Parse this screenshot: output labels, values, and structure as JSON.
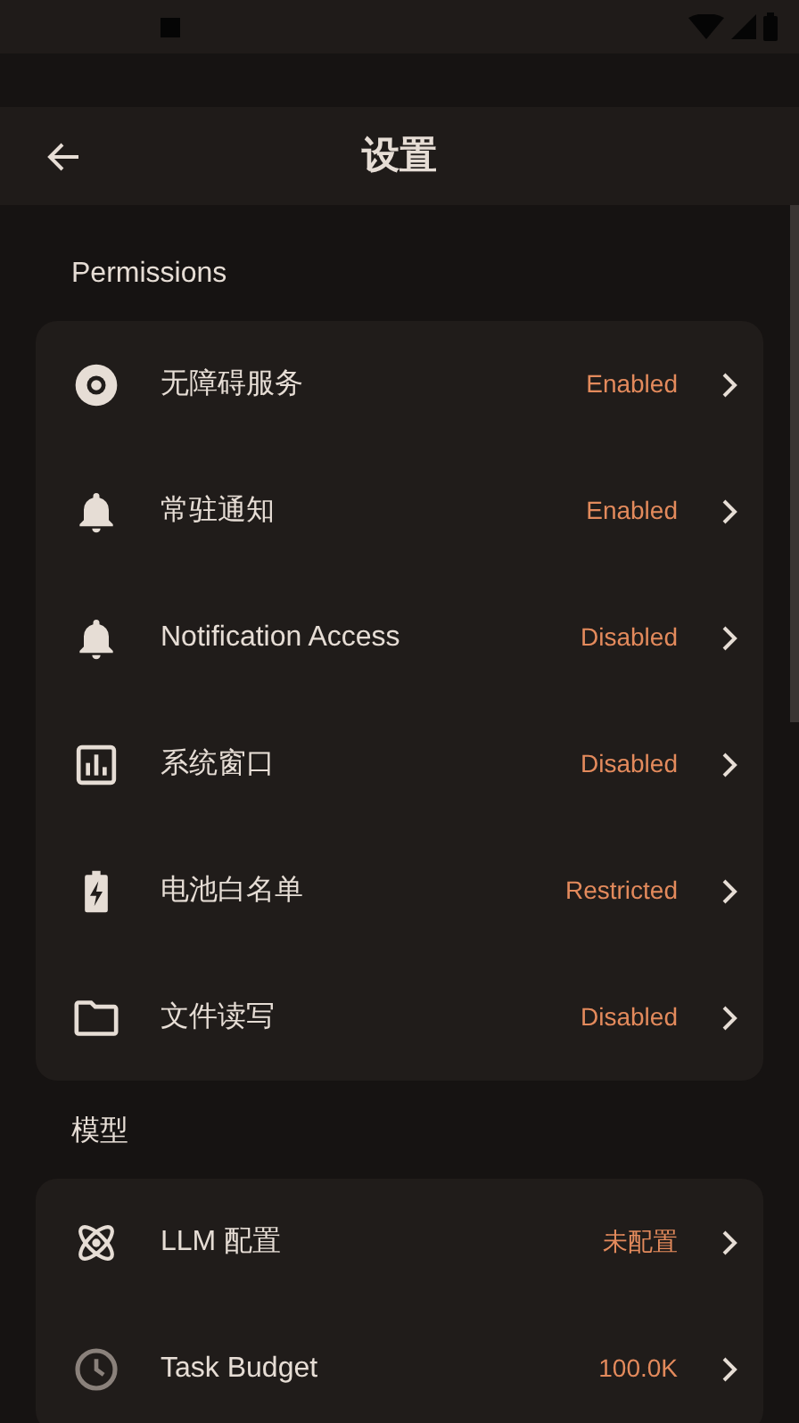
{
  "app_bar": {
    "title": "设置"
  },
  "sections": [
    {
      "title": "Permissions",
      "items": [
        {
          "label": "无障碍服务",
          "status": "Enabled"
        },
        {
          "label": "常驻通知",
          "status": "Enabled"
        },
        {
          "label": "Notification Access",
          "status": "Disabled"
        },
        {
          "label": "系统窗口",
          "status": "Disabled"
        },
        {
          "label": "电池白名单",
          "status": "Restricted"
        },
        {
          "label": "文件读写",
          "status": "Disabled"
        }
      ]
    },
    {
      "title": "模型",
      "items": [
        {
          "label": "LLM 配置",
          "status": "未配置"
        },
        {
          "label": "Task Budget",
          "status": "100.0K"
        }
      ]
    }
  ]
}
